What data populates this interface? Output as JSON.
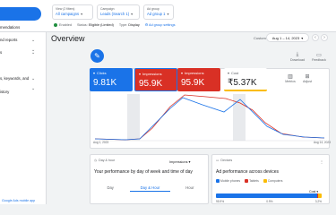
{
  "topbar": {
    "crumbs": [
      {
        "label": "View (2 filters)",
        "value": "All campaigns"
      },
      {
        "label": "Campaign",
        "value": "Leads (Search 1)"
      },
      {
        "label": "Ad group",
        "value": "Ad group 1"
      }
    ],
    "status_label": "Enabled",
    "status_key": "Status:",
    "status_value": "Eligible (Limited)",
    "type_key": "Type:",
    "type_value": "Display",
    "add_settings": "Ad group settings"
  },
  "nav": {
    "items": [
      {
        "label": "mendations",
        "chevron": false
      },
      {
        "label": "nd reports",
        "chevron": true
      },
      {
        "label": "",
        "chevron": true
      },
      {
        "label": "s",
        "chevron": true
      },
      {
        "label": "s, keywords, and",
        "chevron": true
      },
      {
        "label": "",
        "chevron": true
      },
      {
        "label": "istory",
        "chevron": false
      }
    ],
    "footer": "Google Ads mobile app"
  },
  "overview": {
    "title": "Overview",
    "custom_label": "Custom",
    "date_range": "Aug 1 – 14, 2023"
  },
  "tools": {
    "download": "Download",
    "feedback": "Feedback",
    "metrics": "Metrics",
    "adjust": "Adjust"
  },
  "metrics": [
    {
      "label": "Clicks",
      "value": "9.81K"
    },
    {
      "label": "Impressions",
      "value": "95.9K"
    },
    {
      "label": "Impressions",
      "value": "95.9K"
    },
    {
      "label": "Cost",
      "value": "₹5.37K"
    }
  ],
  "chart": {
    "x_start": "Aug 1, 2023",
    "x_end": "Aug 14, 2023",
    "colors": {
      "clicks": "#1a73e8",
      "impressions": "#d93025"
    },
    "shade_color": "#e8eaed"
  },
  "day_hour_card": {
    "header": "Day & hour",
    "metric_select": "Impressions",
    "title": "Your performance by day of week and time of day",
    "tabs": [
      {
        "label": "Day",
        "active": false
      },
      {
        "label": "Day & Hour",
        "active": true
      },
      {
        "label": "Hour",
        "active": false
      }
    ]
  },
  "devices_card": {
    "header": "Devices",
    "title": "Ad performance across devices",
    "legend": [
      {
        "label": "Mobile phones",
        "color": "#1a73e8"
      },
      {
        "label": "Tablets",
        "color": "#d93025"
      },
      {
        "label": "Computers",
        "color": "#fbbc04"
      }
    ],
    "metric_select": "Cost",
    "shares": [
      {
        "label": "95.9%",
        "fraction": 0.959,
        "color": "#1a73e8"
      },
      {
        "label": "0.9%",
        "fraction": 0.009,
        "color": "#d93025"
      },
      {
        "label": "3.2%",
        "fraction": 0.032,
        "color": "#fbbc04"
      }
    ]
  }
}
